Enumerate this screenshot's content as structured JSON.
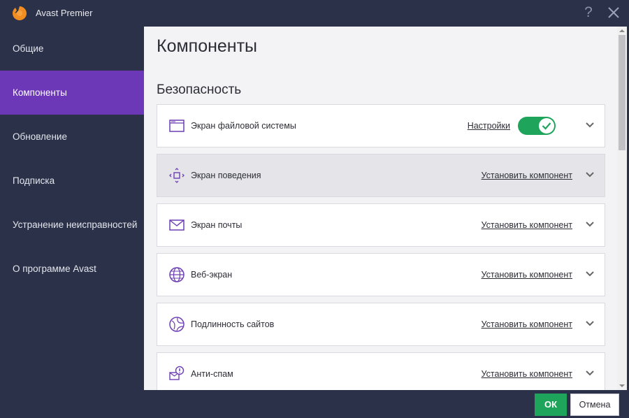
{
  "window": {
    "title": "Avast Premier",
    "help_label": "?",
    "logo_icon": "avast-logo-icon",
    "close_icon": "close-icon"
  },
  "sidebar": {
    "items": [
      {
        "label": "Общие",
        "active": false
      },
      {
        "label": "Компоненты",
        "active": true
      },
      {
        "label": "Обновление",
        "active": false
      },
      {
        "label": "Подписка",
        "active": false
      },
      {
        "label": "Устранение неисправностей",
        "active": false
      },
      {
        "label": "О программе Avast",
        "active": false
      }
    ]
  },
  "main": {
    "title": "Компоненты",
    "section_title": "Безопасность",
    "components": [
      {
        "name": "Экран файловой системы",
        "icon": "file-system-icon",
        "link": "Настройки",
        "toggle_on": true
      },
      {
        "name": "Экран поведения",
        "icon": "behavior-icon",
        "link": "Установить компонент"
      },
      {
        "name": "Экран почты",
        "icon": "mail-icon",
        "link": "Установить компонент"
      },
      {
        "name": "Веб-экран",
        "icon": "globe-icon",
        "link": "Установить компонент"
      },
      {
        "name": "Подлинность сайтов",
        "icon": "site-authenticity-icon",
        "link": "Установить компонент"
      },
      {
        "name": "Анти-спам",
        "icon": "anti-spam-icon",
        "link": "Установить компонент"
      }
    ]
  },
  "footer": {
    "ok_label": "ОК",
    "cancel_label": "Отмена"
  },
  "colors": {
    "sidebar_bg": "#2b3148",
    "active_nav": "#6c38b7",
    "toggle_on": "#1fa55b",
    "ok_button": "#1fa55b",
    "icon_purple": "#6d3fb4"
  }
}
